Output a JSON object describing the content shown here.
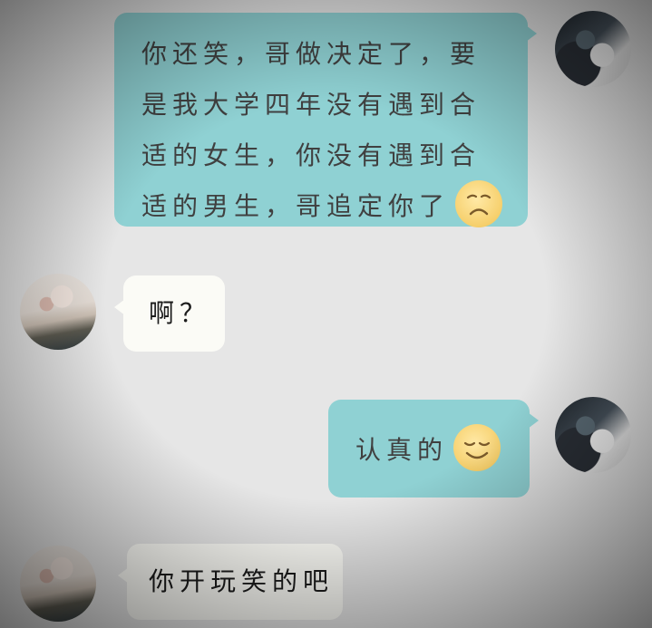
{
  "messages": [
    {
      "sender": "me",
      "text": "你还笑，哥做决定了，要是我大学四年没有遇到合适的女生，你没有遇到合适的男生，哥追定你了",
      "emoji": "sad-face-emoji"
    },
    {
      "sender": "other",
      "text": "啊？"
    },
    {
      "sender": "me",
      "text": "认真的",
      "emoji": "smile-face-emoji"
    },
    {
      "sender": "other",
      "text": "你开玩笑的吧"
    }
  ],
  "colors": {
    "me_bubble": "#8fd1d3",
    "other_bubble": "#fbfbf6",
    "background": "#e6e6e6"
  }
}
